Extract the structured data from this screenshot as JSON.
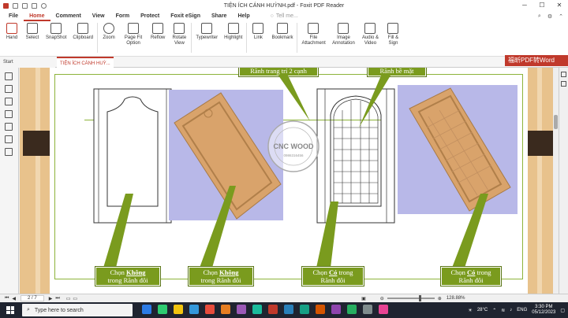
{
  "window": {
    "title": "TIỆN ÍCH CÁNH HUỲNH.pdf - Foxit PDF Reader"
  },
  "menu": [
    "File",
    "Home",
    "Comment",
    "View",
    "Form",
    "Protect",
    "Foxit eSign",
    "Share",
    "Help"
  ],
  "tell_me": "Tell me...",
  "ribbon": [
    {
      "label": "Hand",
      "icon": "hand-icon"
    },
    {
      "label": "Select",
      "icon": "select-icon"
    },
    {
      "label": "SnapShot",
      "icon": "snapshot-icon"
    },
    {
      "label": "Clipboard",
      "icon": "clipboard-icon"
    },
    {
      "label": "Zoom",
      "icon": "zoom-icon"
    },
    {
      "label": "Page Fit Option",
      "icon": "page-fit-icon"
    },
    {
      "label": "Reflow",
      "icon": "reflow-icon"
    },
    {
      "label": "Rotate View",
      "icon": "rotate-icon"
    },
    {
      "label": "Typewriter",
      "icon": "typewriter-icon"
    },
    {
      "label": "Highlight",
      "icon": "highlight-icon"
    },
    {
      "label": "Link",
      "icon": "link-icon"
    },
    {
      "label": "Bookmark",
      "icon": "bookmark-icon"
    },
    {
      "label": "File Attachment",
      "icon": "file-attachment-icon"
    },
    {
      "label": "Image Annotation",
      "icon": "image-annotation-icon"
    },
    {
      "label": "Audio & Video",
      "icon": "audio-video-icon"
    },
    {
      "label": "Fill & Sign",
      "icon": "fill-sign-icon"
    }
  ],
  "tabs": {
    "start": "Start",
    "doc": "TIỆN ÍCH CÁNH HUỲ..."
  },
  "ad_banner": "福昕PDF转Word",
  "document": {
    "top_label_1": "Rãnh trang trí 2 cạnh",
    "top_label_2": "Rãnh bề mặt",
    "watermark": "CNC WOOD",
    "watermark_phone": "0986316456",
    "captions": [
      {
        "pre": "Chọn ",
        "em": "Không",
        "line2": "trong Rãnh đôi"
      },
      {
        "pre": "Chọn ",
        "em": "Không",
        "line2": "trong Rãnh đôi"
      },
      {
        "pre": "Chọn ",
        "em": "Có",
        "post": " trong",
        "line2": "Rãnh đôi"
      },
      {
        "pre": "Chọn ",
        "em": "Có",
        "post": " trong",
        "line2": "Rãnh đôi"
      }
    ]
  },
  "status": {
    "page": "2 / 7",
    "zoom": "128.88%"
  },
  "taskbar": {
    "search": "Type here to search",
    "weather": "28°C",
    "lang": "ENG",
    "time": "3:30 PM",
    "date": "05/12/2023"
  },
  "colors": {
    "accent": "#c0392b",
    "caption_green": "#7a9b1e",
    "wood": "#d9a36b",
    "background_wood": "#e8c28c"
  }
}
